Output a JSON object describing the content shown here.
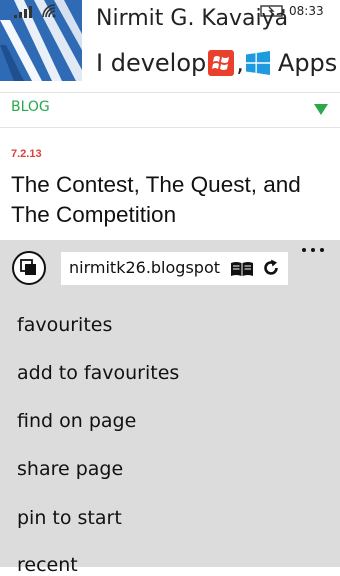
{
  "status_bar": {
    "time": "08:33",
    "signal_icon": "signal-bars-icon",
    "wifi_icon": "wifi-icon",
    "battery_icon": "battery-charging-icon"
  },
  "header": {
    "blog_name": "Nirmit G. Kavaiya",
    "tagline_start": "I develop",
    "tagline_separator": ",",
    "tagline_end": "Apps"
  },
  "nav": {
    "label": "BLOG"
  },
  "post": {
    "date": "7.2.13",
    "title": "The Contest, The Quest, and The Competition"
  },
  "app_bar": {
    "address": "nirmitk26.blogspot",
    "menu_items": [
      "favourites",
      "add to favourites",
      "find on page",
      "share page",
      "pin to start",
      "recent"
    ]
  },
  "colors": {
    "accent_green": "#2aa84a",
    "date_red": "#d9423a",
    "app_bar_bg": "#dcdcdc",
    "logo_blue": "#2f6bb4"
  }
}
